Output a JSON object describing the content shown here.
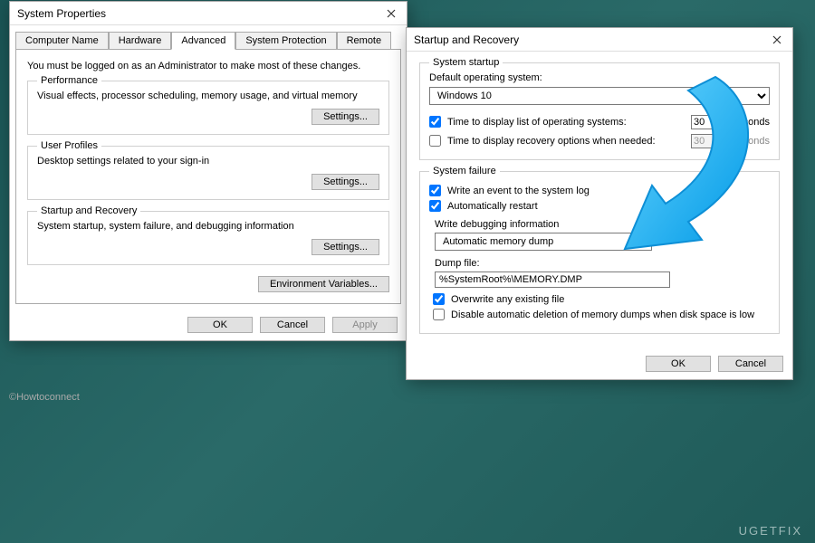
{
  "watermark": "©Howtoconnect",
  "brand": "UGETFIX",
  "sysprops": {
    "title": "System Properties",
    "tabs": [
      "Computer Name",
      "Hardware",
      "Advanced",
      "System Protection",
      "Remote"
    ],
    "activeTab": "Advanced",
    "intro": "You must be logged on as an Administrator to make most of these changes.",
    "groups": {
      "performance": {
        "title": "Performance",
        "desc": "Visual effects, processor scheduling, memory usage, and virtual memory",
        "button": "Settings..."
      },
      "profiles": {
        "title": "User Profiles",
        "desc": "Desktop settings related to your sign-in",
        "button": "Settings..."
      },
      "startup": {
        "title": "Startup and Recovery",
        "desc": "System startup, system failure, and debugging information",
        "button": "Settings..."
      }
    },
    "envvars": "Environment Variables...",
    "buttons": {
      "ok": "OK",
      "cancel": "Cancel",
      "apply": "Apply"
    }
  },
  "recovery": {
    "title": "Startup and Recovery",
    "systemStartup": {
      "title": "System startup",
      "defaultOS_label": "Default operating system:",
      "defaultOS": "Windows 10",
      "listTime_label": "Time to display list of operating systems:",
      "listTime_value": "30",
      "listTime_unit": "seconds",
      "recoveryTime_label": "Time to display recovery options when needed:",
      "recoveryTime_value": "30",
      "recoveryTime_unit": "seconds"
    },
    "systemFailure": {
      "title": "System failure",
      "writeEvent": "Write an event to the system log",
      "autoRestart": "Automatically restart",
      "writeDebug_label": "Write debugging information",
      "dumpType": "Automatic memory dump",
      "dumpFile_label": "Dump file:",
      "dumpFile": "%SystemRoot%\\MEMORY.DMP",
      "overwrite": "Overwrite any existing file",
      "disableDelete": "Disable automatic deletion of memory dumps when disk space is low"
    },
    "buttons": {
      "ok": "OK",
      "cancel": "Cancel"
    }
  }
}
